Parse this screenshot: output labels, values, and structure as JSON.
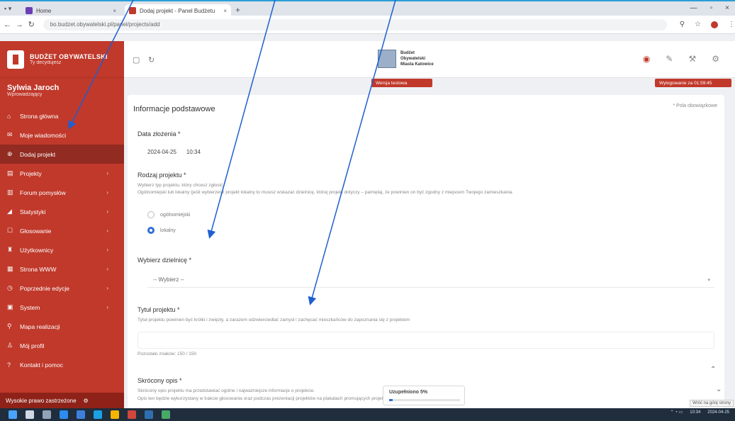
{
  "browser": {
    "tabs": [
      {
        "label": "Home"
      },
      {
        "label": "Dodaj projekt - Panel Budżetu"
      }
    ],
    "url": "bo.budzet.obywatelski.pl/panel/projects/add"
  },
  "sidebar": {
    "logo_title": "BUDŻET OBYWATELSKI",
    "logo_subtitle": "Ty decydujesz",
    "user_name": "Sylwia Jaroch",
    "user_role": "Wprowadzający",
    "items": [
      {
        "label": "Strona główna",
        "icon": "home-icon"
      },
      {
        "label": "Moje wiadomości",
        "icon": "mail-icon"
      },
      {
        "label": "Dodaj projekt",
        "icon": "plus-icon"
      },
      {
        "label": "Projekty",
        "icon": "doc-icon"
      },
      {
        "label": "Forum pomysłów",
        "icon": "forum-icon"
      },
      {
        "label": "Statystyki",
        "icon": "chart-icon"
      },
      {
        "label": "Głosowanie",
        "icon": "vote-icon"
      },
      {
        "label": "Użytkownicy",
        "icon": "users-icon"
      },
      {
        "label": "Strona WWW",
        "icon": "web-icon"
      },
      {
        "label": "Poprzednie edycje",
        "icon": "history-icon"
      },
      {
        "label": "System",
        "icon": "system-icon"
      },
      {
        "label": "Mapa realizacji",
        "icon": "map-icon"
      },
      {
        "label": "Mój profil",
        "icon": "user-icon"
      },
      {
        "label": "Kontakt i pomoc",
        "icon": "help-icon"
      }
    ],
    "footer": "Wysokie prawo zastrzeżone"
  },
  "appbar": {
    "brand_line1": "Budżet",
    "brand_line2": "Obywatelski",
    "brand_line3": "Miasta Katowice",
    "warning_pill": "Wersja testowa",
    "session_pill": "Wylogowanie za 01:59:45"
  },
  "form": {
    "section_title": "Informacje podstawowe",
    "required_note": "* Pola obowiązkowe",
    "date_label": "Data złożenia *",
    "date_value": "2024-04-25",
    "time_value": "10:34",
    "type_label": "Rodzaj projektu *",
    "type_hint1": "Wybierz typ projektu, który chcesz zgłosić.",
    "type_hint2": "Ogólnomiejski lub lokalny (jeśli wybierzesz projekt lokalny to musisz wskazać dzielnicę, której projekt dotyczy – pamiętaj, że powinien on być zgodny z miejscem Twojego zamieszkania.",
    "radio1": "ogólnomiejski",
    "radio2": "lokalny",
    "district_label": "Wybierz dzielnicę *",
    "district_placeholder": "-- Wybierz --",
    "title_label": "Tytuł projektu *",
    "title_hint": "Tytuł projektu powinien być krótki i zwięzły, a zarazem odzwierciedlać zamysł i zachęcać mieszkańców do zapoznania się z projektem",
    "chars_left": "Pozostało znaków: 150 / 150",
    "desc_label": "Skrócony opis *",
    "desc_hint1": "Skrócony opis projektu ma przedstawiać ogólne i najważniejsze informacje o projekcie.",
    "desc_hint2": "Opis ten będzie wykorzystany w trakcie głosowania oraz podczas prezentacji projektów na plakatach promujących projekt"
  },
  "progress": {
    "label": "Uzupełniono 5%",
    "percent": 5
  },
  "tooltip": "Wróć na górę strony",
  "taskbar": {
    "time": "10:34",
    "date": "2024-04-25"
  },
  "colors": {
    "brand_red": "#c0392b",
    "active_red": "#922b21",
    "accent_blue": "#2e6fd8",
    "arrow_blue": "#1f5fd0"
  }
}
